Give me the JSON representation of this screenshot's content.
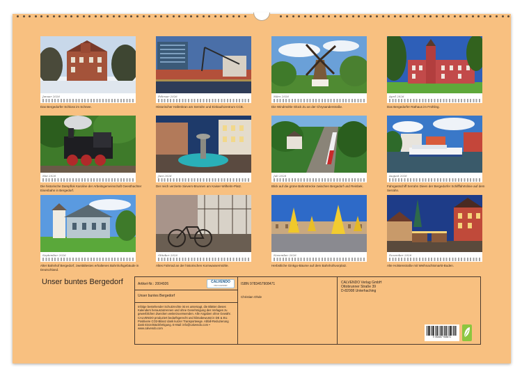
{
  "months": [
    {
      "month": "Januar 2026",
      "caption": "Das Bergedorfer Schloss im Schnee."
    },
    {
      "month": "Februar 2026",
      "caption": "Historischer Hafenkran am Serrahn und Einkaufszentrum CCB."
    },
    {
      "month": "März 2026",
      "caption": "Die Windmühle Glück Zu an der Chrysanderstraße."
    },
    {
      "month": "April 2026",
      "caption": "Das Bergedorfer Rathaus im Frühling."
    },
    {
      "month": "Mai 2026",
      "caption": "Die historische Dampflok Karoline der Arbeitsgemeinschaft Geesthachter Eisenbahn in Bergedorf."
    },
    {
      "month": "Juni 2026",
      "caption": "Der reich verzierte Sievers-Brunnen am Kaiser-Wilhelm-Platz."
    },
    {
      "month": "Juli 2026",
      "caption": "Blick auf die grüne Bahnstrecke zwischen Bergedorf und Reinbek."
    },
    {
      "month": "August 2026",
      "caption": "Fahrgastschiff Serrahn Dieen der Bergedorfer Schifffahrtslinie auf dem Serrahn."
    },
    {
      "month": "September 2026",
      "caption": "Alter Bahnhof Bergedorf, zweitältestes erhaltenes Bahnhofsgebäude in Deutschland."
    },
    {
      "month": "Oktober 2026",
      "caption": "Altes Fahrrad an der historischen Kornwassermühle."
    },
    {
      "month": "November 2026",
      "caption": "Herbstliche Ginkgo-Bäume auf dem Bahnhofsvorplatz."
    },
    {
      "month": "Dezember 2026",
      "caption": "Alte Holstenstraße mit Weihnachtsmarkt-Buden."
    }
  ],
  "title": "Unser buntes Bergedorf",
  "info": {
    "article_no": "Artikel-Nr.: 2004926",
    "logo_name": "CALVENDO",
    "logo_slogan": "DIE KALENDER",
    "product_title": "Unser buntes Bergedorf",
    "disclaimer": "Infolge bestehender Schutzrechte ist es untersagt, die Blätter dieses Kalenders herauszutrennen und ohne Genehmigung des Verlages zu gewerblichen Zwecken weiterzuverwenden. Alle Angaben ohne Gewähr. CALVENDO produziert bedarfsgerecht und klimabewusst in DE & EU. Positivere CO2-Bilanz dank kurzer Transportwege. Abfall-Reduzierung dank Einzelstückfertigung. E-Mail: info@calvendo.com • www.calvendo.com",
    "isbn": "ISBN 9783457908471",
    "author": "Christian Ohde",
    "publisher": "CALVENDO Verlag GmbH",
    "street": "Ottobrunner Straße 39",
    "city": "D-82008 Unterhaching",
    "barcode_number": "9 783457 908471"
  },
  "colors": {
    "background": "#f8c080",
    "border": "#4a3a2e",
    "text": "#2c2420"
  }
}
